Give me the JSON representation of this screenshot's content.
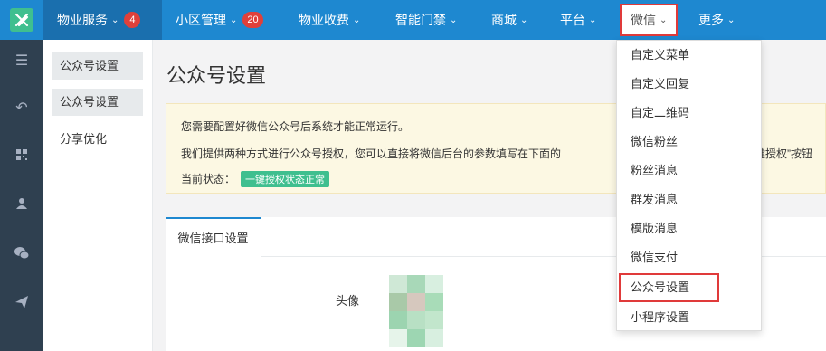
{
  "nav": {
    "items": [
      {
        "label": "物业服务",
        "badge": "4"
      },
      {
        "label": "小区管理",
        "badge": "20"
      },
      {
        "label": "物业收费"
      },
      {
        "label": "智能门禁"
      },
      {
        "label": "商城"
      },
      {
        "label": "平台"
      },
      {
        "label": "微信"
      },
      {
        "label": "更多"
      }
    ]
  },
  "dropdown": {
    "items": [
      "自定义菜单",
      "自定义回复",
      "自定二维码",
      "微信粉丝",
      "粉丝消息",
      "群发消息",
      "模版消息",
      "微信支付",
      "公众号设置",
      "小程序设置"
    ],
    "highlighted": "公众号设置"
  },
  "sidebar_icons": [
    "list-icon",
    "reply-icon",
    "qrcode-icon",
    "user-icon",
    "wechat-icon",
    "send-icon"
  ],
  "submenu": {
    "items": [
      "公众号设置",
      "公众号设置",
      "分享优化"
    ]
  },
  "main": {
    "title": "公众号设置",
    "notice": {
      "line1": "您需要配置好微信公众号后系统才能正常运行。",
      "line2": "我们提供两种方式进行公众号授权，您可以直接将微信后台的参数填写在下面的",
      "line2_tail": "键授权”按钮",
      "status_label": "当前状态：",
      "status_value": "一键授权状态正常"
    },
    "tab_label": "微信接口设置",
    "avatar_label": "头像"
  },
  "colors": {
    "nav_bg": "#1e88d0",
    "sidebar_bg": "#2f4050",
    "accent_green": "#3fbf8f",
    "highlight_red": "#e03a3a",
    "badge_red": "#e0403a"
  }
}
